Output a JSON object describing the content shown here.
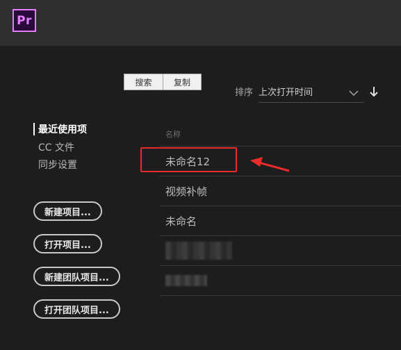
{
  "app": {
    "logo_text": "Pr"
  },
  "overlay": {
    "search_label": "搜索",
    "copy_label": "复制"
  },
  "sort": {
    "label": "排序",
    "value": "上次打开时间"
  },
  "nav": {
    "items": [
      {
        "label": "最近使用项",
        "active": true
      },
      {
        "label": "CC 文件",
        "active": false
      },
      {
        "label": "同步设置",
        "active": false
      }
    ]
  },
  "buttons": {
    "new_project": "新建项目...",
    "open_project": "打开项目...",
    "new_team_project": "新建团队项目...",
    "open_team_project": "打开团队项目..."
  },
  "list": {
    "header": "名称",
    "rows": [
      "未命名12",
      "视频补帧",
      "未命名",
      "",
      ""
    ]
  },
  "colors": {
    "accent": "#e77cff",
    "highlight": "#e82b2b"
  }
}
